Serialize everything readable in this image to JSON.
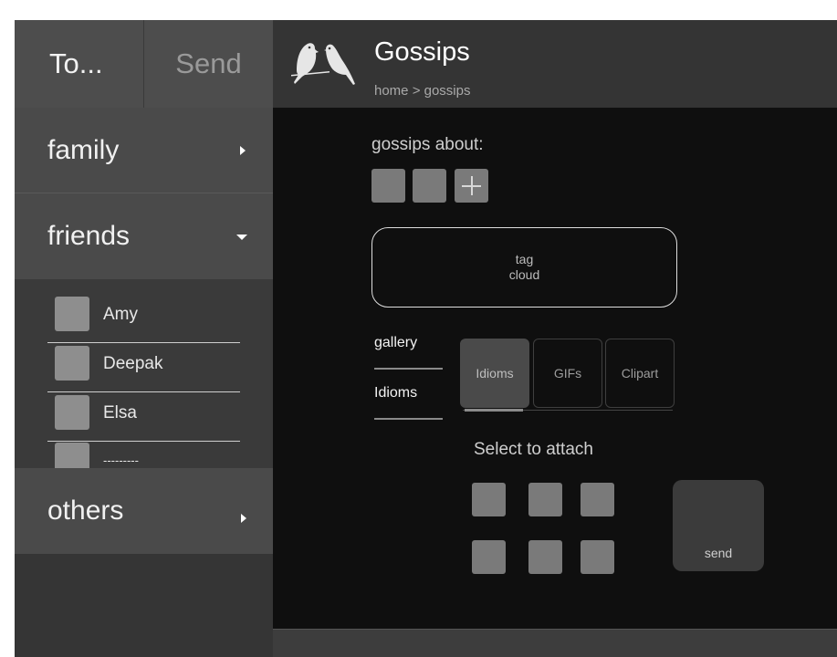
{
  "sidebar": {
    "tabs": {
      "to": "To...",
      "send": "Send"
    },
    "groups": {
      "family": "family",
      "friends": "friends",
      "others": "others"
    },
    "friends": [
      "Amy",
      "Deepak",
      "Elsa",
      "---------"
    ]
  },
  "header": {
    "title": "Gossips",
    "breadcrumb": "home > gossips"
  },
  "main": {
    "gossips_about_label": "gossips about:",
    "tag_cloud": {
      "line1": "tag",
      "line2": "cloud"
    },
    "side_nav": [
      "gallery",
      "Idioms"
    ],
    "segments": [
      "Idioms",
      "GIFs",
      "Clipart"
    ],
    "active_segment": "Idioms",
    "attach_label": "Select to attach",
    "send_label": "send"
  },
  "colors": {
    "sidebar_bg": "#353535",
    "header_bg": "#343434",
    "main_bg": "#0f0f0f",
    "tile": "#7a7a7a"
  },
  "icons": [
    "birds-logo-icon",
    "chevron-right-icon",
    "chevron-down-icon",
    "plus-icon"
  ]
}
